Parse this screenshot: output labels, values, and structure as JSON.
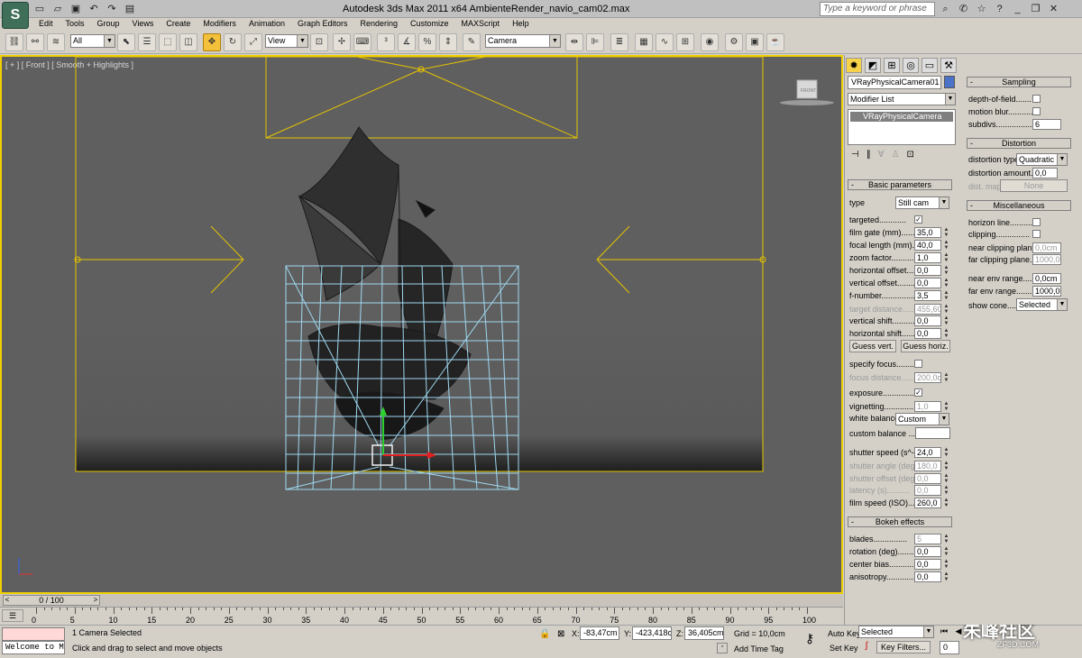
{
  "app": {
    "title": "Autodesk 3ds Max  2011 x64    AmbienteRender_navio_cam02.max",
    "logo": "3ds-max-logo",
    "search_placeholder": "Type a keyword or phrase"
  },
  "menu": [
    "Edit",
    "Tools",
    "Group",
    "Views",
    "Create",
    "Modifiers",
    "Animation",
    "Graph Editors",
    "Rendering",
    "Customize",
    "MAXScript",
    "Help"
  ],
  "toolbar": {
    "selection_filter": "All",
    "ref_coord": "View",
    "named_selection": "Camera"
  },
  "viewport": {
    "label": "[ + ] [ Front ] [ Smooth + Highlights ]",
    "viewcube_label": "FRONT"
  },
  "timeline": {
    "frame_slider": "0 / 100",
    "ticks": [
      "0",
      "5",
      "10",
      "15",
      "20",
      "25",
      "30",
      "35",
      "40",
      "45",
      "50",
      "55",
      "60",
      "65",
      "70",
      "75",
      "80",
      "85",
      "90",
      "95",
      "100"
    ]
  },
  "status": {
    "maxscript_listener": "Welcome to M.",
    "selection_info": "1 Camera Selected",
    "prompt": "Click and drag to select and move objects",
    "x_label": "X:",
    "x_value": "-83,47cm",
    "y_label": "Y:",
    "y_value": "-423,418cr",
    "z_label": "Z:",
    "z_value": "36,405cm",
    "grid": "Grid = 10,0cm",
    "add_time_tag": "Add Time Tag",
    "auto_key": "Auto Key",
    "set_key": "Set Key",
    "key_mode": "Selected",
    "key_filters": "Key Filters...",
    "frame": "0"
  },
  "command_panel": {
    "object_name": "VRayPhysicalCamera01",
    "object_color": "#4a72c8",
    "modifier_list": "Modifier List",
    "stack_item": "VRayPhysicalCamera",
    "basic": {
      "title": "Basic parameters",
      "type_label": "type",
      "type_value": "Still cam",
      "guess_vert": "Guess vert.",
      "guess_horiz": "Guess horiz.",
      "white_balance_label": "white balance",
      "white_balance_value": "Custom",
      "custom_balance_label": "custom balance ....",
      "rows": [
        {
          "label": "targeted............",
          "checked": true
        },
        {
          "label": "film gate (mm).......",
          "value": "35,0"
        },
        {
          "label": "focal length (mm)....",
          "value": "40,0"
        },
        {
          "label": "zoom factor...........",
          "value": "1,0"
        },
        {
          "label": "horizontal offset......",
          "value": "0,0"
        },
        {
          "label": "vertical offset.........",
          "value": "0,0"
        },
        {
          "label": "f-number................",
          "value": "3,5"
        },
        {
          "label": "target distance.......",
          "value": "455,60",
          "disabled": true
        },
        {
          "label": "vertical shift...........",
          "value": "0,0"
        },
        {
          "label": "horizontal shift........",
          "value": "0,0"
        },
        {
          "label": "specify focus.........",
          "checked": false
        },
        {
          "label": "focus distance.........",
          "value": "200,0cr",
          "disabled": true
        },
        {
          "label": "exposure.................",
          "checked": true
        },
        {
          "label": "vignetting.............",
          "checked": false,
          "value": "1,0",
          "disabled_value": true
        },
        {
          "label": "shutter speed (s^-1",
          "value": "24,0"
        },
        {
          "label": "shutter angle (deg)",
          "value": "180,0",
          "disabled": true
        },
        {
          "label": "shutter offset (deg)",
          "value": "0,0",
          "disabled": true
        },
        {
          "label": "latency (s)..........",
          "value": "0,0",
          "disabled": true
        },
        {
          "label": "film speed (ISO).....",
          "value": "260,0"
        }
      ]
    },
    "bokeh": {
      "title": "Bokeh effects",
      "rows": [
        {
          "label": "blades...............",
          "checked": false,
          "value": "5",
          "disabled_value": true
        },
        {
          "label": "rotation (deg)........",
          "value": "0,0"
        },
        {
          "label": "center bias...........",
          "value": "0,0"
        },
        {
          "label": "anisotropy.............",
          "value": "0,0"
        }
      ]
    },
    "sampling": {
      "title": "Sampling",
      "dof_label": "depth-of-field.......",
      "mb_label": "motion blur...........",
      "subdivs_label": "subdivs....................",
      "subdivs_value": "6"
    },
    "distortion": {
      "title": "Distortion",
      "type_label": "distortion type.",
      "type_value": "Quadratic",
      "amount_label": "distortion amount...",
      "amount_value": "0,0",
      "map_label": "dist. map",
      "map_button": "None"
    },
    "misc": {
      "title": "Miscellaneous",
      "horizon_label": "horizon line..........",
      "clipping_label": "clipping...............",
      "near_clip_label": "near clipping plane..",
      "near_clip_value": "0,0cm",
      "far_clip_label": "far clipping plane...",
      "far_clip_value": "1000,0c",
      "near_env_label": "near env range.......",
      "near_env_value": "0,0cm",
      "far_env_label": "far env range........",
      "far_env_value": "1000,0c",
      "show_cone_label": "show cone.........",
      "show_cone_value": "Selected"
    }
  },
  "watermark": {
    "main": "朱峰社区",
    "sub": "ZF3D.COM"
  }
}
